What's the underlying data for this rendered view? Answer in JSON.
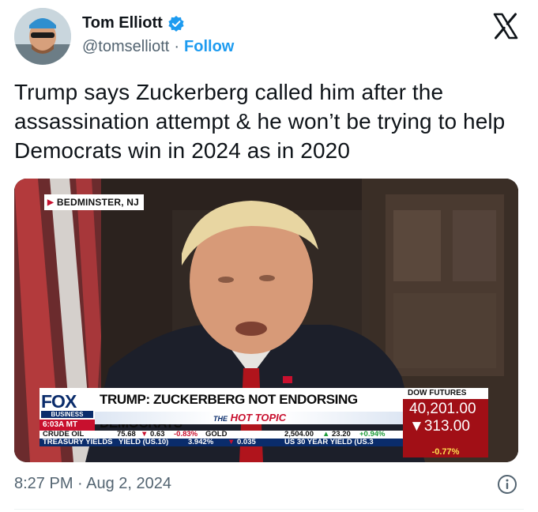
{
  "author": {
    "display_name": "Tom Elliott",
    "handle": "@tomselliott",
    "separator": "·",
    "follow_label": "Follow",
    "verified_icon": "verified-badge-icon"
  },
  "platform_logo": "x-logo-icon",
  "tweet": {
    "text": "Trump says Zuckerberg called him after the assassination attempt & he won’t be trying to help Democrats win in 2024 as in 2020"
  },
  "video": {
    "location": "BEDMINSTER, NJ",
    "network": "FOX",
    "network_sub": "BUSINESS",
    "clock": "6:03A MT",
    "headline": "TRUMP: ZUCKERBERG NOT ENDORSING DEMOCRATS",
    "hot_topic_prefix": "THE",
    "hot_topic": "HOT TOPIC",
    "dow_label": "DOW FUTURES",
    "dow_value": "40,201.00",
    "dow_change": "313.00",
    "dow_pct": "-0.77%",
    "ticker_row1": {
      "crude_label": "CRUDE OIL",
      "crude_value": "75.68",
      "crude_change": "0.63",
      "crude_pct": "-0.83%",
      "gold_label": "GOLD",
      "gold_value": "2,504.00",
      "gold_change": "23.20",
      "gold_pct": "+0.94%"
    },
    "ticker_row2": {
      "label": "TREASURY YIELDS",
      "item1": "YIELD (US.10)",
      "item1_value": "3.942%",
      "item1_change": "0.035",
      "item2": "US 30 YEAR YIELD (US.3"
    },
    "colors": {
      "fox_red": "#c8102e",
      "fox_navy": "#0a2c6b",
      "dow_panel": "#a10f16"
    }
  },
  "footer": {
    "timestamp": "8:27 PM · Aug 2, 2024",
    "info_icon": "info-icon"
  },
  "colors": {
    "accent": "#1d9bf0",
    "text_primary": "#0f1419",
    "text_secondary": "#536471"
  }
}
